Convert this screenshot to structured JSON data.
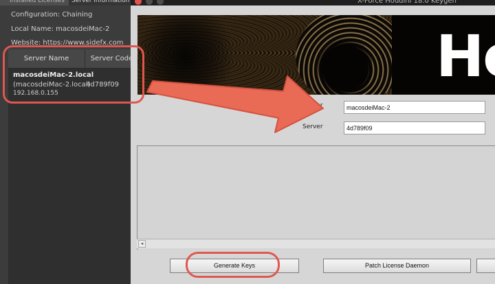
{
  "license_admin": {
    "tabs": [
      "Installed Licenses",
      "Server Information"
    ],
    "configuration": "Configuration: Chaining",
    "local_name": "Local Name: macosdeiMac-2",
    "website": "Website: https://www.sidefx.com",
    "table": {
      "columns": [
        "Server Name",
        "Server Code"
      ],
      "rows": [
        {
          "host": "macosdeiMac-2.local",
          "alias": "(macosdeiMac-2.local)",
          "ip": "192.168.0.155",
          "code": "4d789f09"
        }
      ]
    }
  },
  "keygen": {
    "window_title": "X-Force Houdini 18.0 Keygen",
    "banner_text": "Ho",
    "fields": {
      "server_name_label": "Server",
      "server_name_value": "macosdeiMac-2",
      "server_code_label": "Server",
      "server_code_value": "4d789f09"
    },
    "buttons": {
      "generate": "Generate Keys",
      "patch": "Patch License Daemon"
    },
    "scroll_left_glyph": "◂"
  },
  "colors": {
    "highlight": "#e0574f",
    "arrow": "#e96a55",
    "panel_bg": "#3c3c3c",
    "window_bg": "#d6d6d6"
  }
}
